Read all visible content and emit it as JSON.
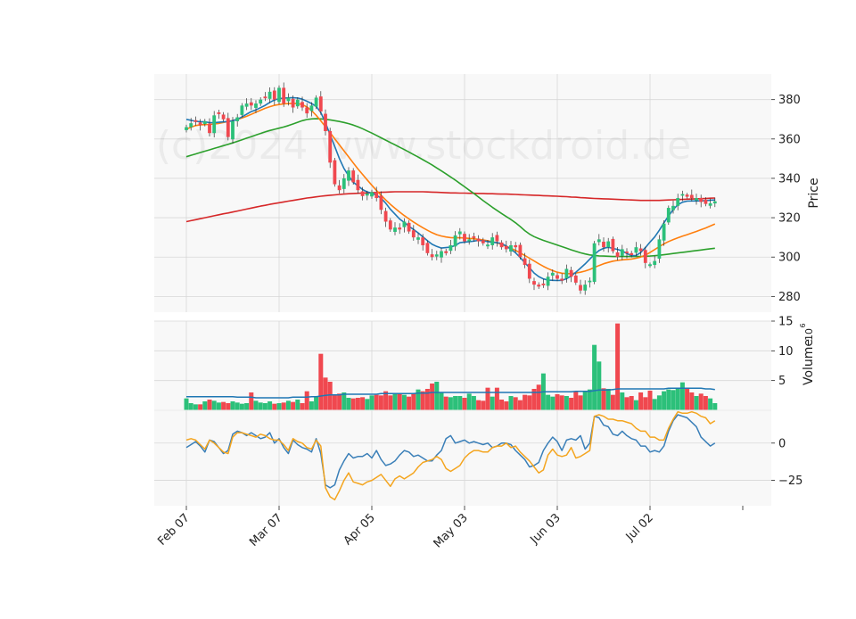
{
  "chart_data": [
    {
      "panel": "price",
      "type": "candlestick",
      "ylabel": "Price",
      "ylim": [
        272,
        393
      ],
      "yticks": [
        280,
        300,
        320,
        340,
        360,
        380
      ],
      "xtick_labels": [
        "Feb 07",
        "Mar 07",
        "Apr 05",
        "May 03",
        "Jun 03",
        "Jul 02"
      ],
      "xtick_index": [
        0,
        20,
        40,
        60,
        80,
        100
      ],
      "watermark": "(c)2024 www.stockdroid.de",
      "grid": true,
      "colors": {
        "up": "#2cc07a",
        "down": "#f0484f",
        "ma_fast": "#1f77b4",
        "ma_mid": "#ff7f0e",
        "ma_slow": "#2ca02c",
        "ma_long": "#d62728"
      },
      "close": [
        366,
        368,
        369,
        367,
        369,
        363,
        372,
        373,
        370,
        361,
        369,
        371,
        377,
        378,
        377,
        378,
        380,
        381,
        384,
        380,
        386,
        378,
        381,
        376,
        380,
        376,
        373,
        377,
        381,
        374,
        364,
        348,
        337,
        334,
        340,
        344,
        338,
        334,
        331,
        332,
        333,
        330,
        324,
        318,
        314,
        315,
        314,
        318,
        313,
        310,
        310,
        306,
        302,
        300,
        301,
        303,
        302,
        306,
        311,
        313,
        308,
        309,
        310,
        308,
        307,
        306,
        310,
        308,
        305,
        304,
        306,
        305,
        300,
        296,
        289,
        286,
        285,
        286,
        290,
        292,
        289,
        288,
        294,
        290,
        287,
        283,
        286,
        288,
        307,
        309,
        305,
        308,
        303,
        300,
        304,
        302,
        301,
        305,
        303,
        297,
        296,
        298,
        309,
        317,
        325,
        326,
        330,
        332,
        331,
        330,
        330,
        328,
        327,
        327,
        328
      ],
      "ma_fast": [
        370,
        369.5,
        369,
        368.8,
        368.7,
        368.3,
        368.3,
        368.5,
        368.7,
        368.8,
        369.3,
        370,
        371.2,
        372.6,
        373.9,
        374.8,
        375.9,
        377.1,
        378.6,
        379.8,
        380.5,
        380.7,
        380.9,
        381,
        380.8,
        380.2,
        379.2,
        378,
        376.6,
        373.4,
        368.3,
        362.1,
        356.2,
        350.1,
        345,
        341.3,
        338,
        336.2,
        334.3,
        333.1,
        332.5,
        331.4,
        329.9,
        327.4,
        324.3,
        321.8,
        319.3,
        317.6,
        315.7,
        314,
        312.3,
        310.3,
        308.3,
        306.5,
        305.4,
        304.6,
        304.8,
        305.1,
        305.9,
        307.3,
        307.6,
        307.8,
        308.1,
        308.5,
        308.3,
        307.9,
        307.5,
        307.3,
        306.9,
        305.6,
        304,
        302.2,
        299.8,
        297.1,
        294.6,
        291.9,
        290.1,
        288.9,
        288.3,
        288.2,
        288.1,
        288.2,
        289,
        290.4,
        292.3,
        294.4,
        296.5,
        298.9,
        301.3,
        303.3,
        304.5,
        305,
        304.4,
        303.9,
        303.1,
        301.8,
        300.7,
        300.8,
        302.3,
        304.8,
        307.6,
        310.2,
        313.6,
        317.4,
        320.9,
        324.1,
        326.6,
        327.9,
        328.4,
        328.5,
        328.5,
        328.6,
        328.7,
        328.9,
        329
      ],
      "ma_mid": [
        365,
        366,
        366.8,
        367.2,
        367.3,
        367.4,
        367.6,
        367.9,
        368.4,
        368.9,
        369.4,
        370,
        370.7,
        371.5,
        372.5,
        373.6,
        374.6,
        375.6,
        376.4,
        377.1,
        377.5,
        377.8,
        378,
        378.1,
        378,
        377.5,
        376.3,
        374.4,
        372,
        369.2,
        366.2,
        363.2,
        360.1,
        357,
        354,
        350.9,
        347.8,
        344.8,
        342,
        339.2,
        336.5,
        333.9,
        331.4,
        329,
        326.8,
        324.8,
        322.9,
        321.1,
        319.4,
        317.8,
        316.3,
        314.9,
        313.6,
        312.4,
        311.4,
        310.7,
        310.2,
        309.9,
        309.8,
        309.8,
        309.7,
        309.5,
        309.3,
        309,
        308.7,
        308.3,
        307.8,
        307.2,
        306.4,
        305.5,
        304.5,
        303.4,
        302.1,
        300.8,
        299.4,
        298,
        296.6,
        295.3,
        294.1,
        293.1,
        292.3,
        291.8,
        291.6,
        291.6,
        291.9,
        292.3,
        292.9,
        293.7,
        294.7,
        295.7,
        296.6,
        297.3,
        297.9,
        298.3,
        298.6,
        298.8,
        299,
        299.4,
        300,
        301,
        302.3,
        303.8,
        305.3,
        306.7,
        307.9,
        308.9,
        309.8,
        310.6,
        311.4,
        312.2,
        313,
        313.9,
        314.8,
        315.8,
        316.8
      ],
      "ma_slow": [
        351,
        351.7,
        352.4,
        353.1,
        353.8,
        354.5,
        355.2,
        355.9,
        356.6,
        357.3,
        358,
        358.8,
        359.6,
        360.4,
        361.2,
        362,
        362.8,
        363.6,
        364.3,
        364.9,
        365.5,
        366.1,
        366.8,
        367.6,
        368.5,
        369.3,
        369.9,
        370.2,
        370.3,
        370.2,
        370,
        369.7,
        369.3,
        368.9,
        368.4,
        367.8,
        367.1,
        366.2,
        365.2,
        364.1,
        363,
        361.8,
        360.6,
        359.4,
        358.2,
        357,
        355.8,
        354.6,
        353.4,
        352.1,
        350.8,
        349.5,
        348.2,
        346.8,
        345.3,
        343.8,
        342.3,
        340.7,
        339.1,
        337.4,
        335.7,
        334,
        332.3,
        330.5,
        328.7,
        327,
        325.3,
        323.7,
        322.1,
        320.6,
        319.1,
        317.4,
        315.5,
        313.4,
        311.7,
        310.4,
        309.4,
        308.5,
        307.7,
        306.9,
        306.1,
        305.3,
        304.5,
        303.7,
        302.9,
        302.2,
        301.6,
        301.1,
        300.8,
        300.6,
        300.5,
        300.4,
        300.3,
        300.3,
        300.3,
        300.3,
        300.3,
        300.3,
        300.3,
        300.4,
        300.5,
        300.7,
        300.9,
        301.2,
        301.5,
        301.8,
        302.1,
        302.4,
        302.7,
        303,
        303.3,
        303.6,
        303.9,
        304.2,
        304.5
      ],
      "ma_long": [
        318,
        318.5,
        319,
        319.5,
        320,
        320.5,
        321,
        321.5,
        322,
        322.4,
        322.9,
        323.4,
        323.9,
        324.4,
        324.9,
        325.4,
        325.9,
        326.3,
        326.8,
        327.2,
        327.6,
        328,
        328.4,
        328.8,
        329.2,
        329.6,
        330,
        330.3,
        330.6,
        330.9,
        331.2,
        331.4,
        331.6,
        331.8,
        332,
        332.2,
        332.3,
        332.4,
        332.5,
        332.6,
        332.7,
        332.8,
        332.9,
        333,
        333.1,
        333.2,
        333.2,
        333.2,
        333.2,
        333.2,
        333.2,
        333.2,
        333.1,
        333,
        332.9,
        332.8,
        332.7,
        332.6,
        332.6,
        332.5,
        332.5,
        332.4,
        332.4,
        332.3,
        332.3,
        332.2,
        332.2,
        332.1,
        332,
        332,
        331.9,
        331.8,
        331.7,
        331.6,
        331.5,
        331.4,
        331.3,
        331.2,
        331.1,
        331,
        330.9,
        330.8,
        330.7,
        330.5,
        330.4,
        330.2,
        330.1,
        329.9,
        329.8,
        329.7,
        329.6,
        329.5,
        329.4,
        329.3,
        329.2,
        329.1,
        329,
        328.9,
        328.8,
        328.8,
        328.8,
        328.8,
        328.8,
        328.9,
        329,
        329.1,
        329.2,
        329.3,
        329.4,
        329.5,
        329.6,
        329.7,
        329.8,
        329.9,
        330
      ]
    },
    {
      "panel": "volume",
      "type": "bar",
      "ylabel": "Volume",
      "yunit": "10^6",
      "ylim": [
        0,
        15
      ],
      "yticks": [
        5,
        10,
        15
      ],
      "values": [
        2,
        1.2,
        1,
        1,
        1.5,
        1.8,
        1.6,
        1.3,
        1.4,
        1.2,
        1.5,
        1.3,
        1.1,
        1.2,
        3,
        1.6,
        1.3,
        1.2,
        1.5,
        1.1,
        1.2,
        1.3,
        1.6,
        1.4,
        1.8,
        1.2,
        3.2,
        1.5,
        2.4,
        9.5,
        5.5,
        4.8,
        2.6,
        2.8,
        3,
        2.1,
        2,
        2.1,
        2.2,
        1.9,
        2.5,
        2.6,
        2.5,
        3.2,
        2.5,
        2.8,
        2.7,
        2.6,
        2.3,
        2.9,
        3.5,
        3.2,
        3.6,
        4.5,
        4.8,
        3,
        2.3,
        2.2,
        2.4,
        2.4,
        2.1,
        2.8,
        2.4,
        1.7,
        1.6,
        3.8,
        2.3,
        3.8,
        1.8,
        1.5,
        2.4,
        2.2,
        1.7,
        2.6,
        2.5,
        3.6,
        4.3,
        6.2,
        2.6,
        2.3,
        2.7,
        2.5,
        2.4,
        2.1,
        3.2,
        2.5,
        3.1,
        3.5,
        11,
        8.2,
        3.7,
        3.6,
        2.6,
        14.6,
        3,
        2.2,
        2.4,
        1.7,
        3,
        2.2,
        3.3,
        1.9,
        2.5,
        3.2,
        3.5,
        3.4,
        3.6,
        4.7,
        3.6,
        3,
        2.4,
        2.8,
        2.4,
        2,
        1.2
      ],
      "ma": [
        2.3,
        2.3,
        2.3,
        2.3,
        2.3,
        2.3,
        2.3,
        2.3,
        2.3,
        2.3,
        2.3,
        2.2,
        2.2,
        2.2,
        2.2,
        2.1,
        2.1,
        2.1,
        2.1,
        2.1,
        2.1,
        2.1,
        2.1,
        2.2,
        2.2,
        2.2,
        2.2,
        2.3,
        2.3,
        2.4,
        2.5,
        2.6,
        2.6,
        2.6,
        2.7,
        2.7,
        2.7,
        2.7,
        2.7,
        2.7,
        2.7,
        2.7,
        2.8,
        2.8,
        2.8,
        2.8,
        2.8,
        2.8,
        2.8,
        2.8,
        2.9,
        2.9,
        2.9,
        3,
        3,
        3,
        3,
        3,
        3,
        3,
        3,
        3,
        3,
        3,
        3,
        3,
        3,
        3,
        3,
        3,
        3,
        3,
        3,
        3,
        3,
        3,
        3,
        3.1,
        3.1,
        3.1,
        3.1,
        3.1,
        3.1,
        3.1,
        3.2,
        3.2,
        3.2,
        3.2,
        3.3,
        3.4,
        3.4,
        3.4,
        3.5,
        3.6,
        3.6,
        3.6,
        3.6,
        3.6,
        3.6,
        3.6,
        3.6,
        3.6,
        3.6,
        3.6,
        3.7,
        3.7,
        3.7,
        3.7,
        3.7,
        3.7,
        3.7,
        3.7,
        3.6,
        3.6,
        3.5
      ],
      "colors": {
        "up": "#2cc07a",
        "down": "#f0484f",
        "ma": "#1f77b4"
      }
    },
    {
      "panel": "oscillator",
      "type": "line",
      "ylim": [
        -42,
        22
      ],
      "yticks": [
        -25,
        0
      ],
      "series": [
        {
          "color": "#3a7fb8",
          "values": [
            -3,
            -1,
            1,
            -2,
            -6,
            2,
            1,
            -3,
            -7,
            -5,
            6,
            8,
            7,
            5,
            7,
            5,
            3,
            4,
            7,
            0,
            3,
            -3,
            -7,
            2,
            -1,
            -3,
            -4,
            -6,
            3,
            -7,
            -28,
            -30,
            -28,
            -18,
            -12,
            -7,
            -10,
            -9,
            -9,
            -7,
            -10,
            -5,
            -11,
            -15,
            -14,
            -12,
            -8,
            -5,
            -6,
            -9,
            -8,
            -10,
            -12,
            -12,
            -8,
            -5,
            3,
            5,
            0,
            1,
            2,
            0,
            1,
            0,
            -1,
            0,
            -3,
            -2,
            0,
            0,
            -1,
            -5,
            -8,
            -11,
            -16,
            -15,
            -13,
            -5,
            0,
            4,
            1,
            -5,
            2,
            3,
            2,
            5,
            -4,
            0,
            18,
            17,
            12,
            11,
            6,
            5,
            8,
            5,
            3,
            2,
            -2,
            -2,
            -6,
            -5,
            -6,
            -2,
            8,
            15,
            19,
            18,
            17,
            14,
            11,
            4,
            1,
            -2,
            0
          ]
        },
        {
          "color": "#f4a51f",
          "values": [
            2,
            3,
            2,
            -1,
            -4,
            2,
            0,
            -3,
            -6,
            -7,
            4,
            7,
            7,
            6,
            5,
            4,
            6,
            5,
            3,
            2,
            2,
            -1,
            -5,
            3,
            1,
            0,
            -3,
            -4,
            2,
            -2,
            -30,
            -36,
            -38,
            -32,
            -25,
            -20,
            -26,
            -27,
            -28,
            -26,
            -25,
            -23,
            -21,
            -25,
            -29,
            -24,
            -22,
            -24,
            -22,
            -20,
            -16,
            -13,
            -12,
            -11,
            -9,
            -11,
            -17,
            -19,
            -17,
            -15,
            -10,
            -7,
            -5,
            -5,
            -6,
            -6,
            -3,
            -2,
            -2,
            0,
            -3,
            -2,
            -6,
            -9,
            -12,
            -16,
            -20,
            -18,
            -8,
            -4,
            -8,
            -9,
            -8,
            -3,
            -10,
            -9,
            -7,
            -5,
            18,
            19,
            18,
            16,
            16,
            15,
            15,
            14,
            13,
            10,
            8,
            8,
            4,
            4,
            2,
            2,
            10,
            16,
            21,
            20,
            20,
            21,
            20,
            18,
            17,
            13,
            15
          ]
        }
      ]
    }
  ]
}
